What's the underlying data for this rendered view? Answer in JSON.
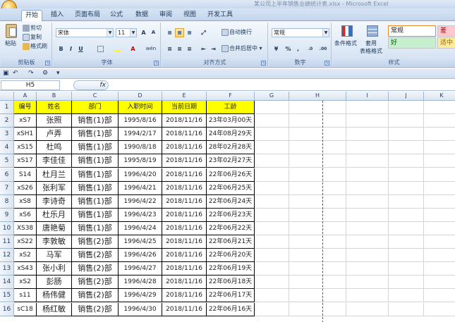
{
  "window": {
    "title": "某公司上半年销售业绩统计表.xlsx - Microsoft Excel"
  },
  "tabs": [
    {
      "label": "开始",
      "active": true
    },
    {
      "label": "插入",
      "active": false
    },
    {
      "label": "页面布局",
      "active": false
    },
    {
      "label": "公式",
      "active": false
    },
    {
      "label": "数据",
      "active": false
    },
    {
      "label": "审阅",
      "active": false
    },
    {
      "label": "视图",
      "active": false
    },
    {
      "label": "开发工具",
      "active": false
    }
  ],
  "ribbon": {
    "clipboard": {
      "label": "剪贴板",
      "paste": "粘贴",
      "cut": "剪切",
      "copy": "复制",
      "format_painter": "格式刷"
    },
    "font": {
      "label": "字体",
      "font_name": "宋体",
      "font_size": "11",
      "grow": "A",
      "shrink": "A",
      "bold": "B",
      "italic": "I",
      "underline": "U",
      "font_color_letter": "A",
      "wen": "wén"
    },
    "alignment": {
      "label": "对齐方式",
      "wrap": "自动换行",
      "merge": "合并后居中"
    },
    "number": {
      "label": "数字",
      "format": "常规",
      "percent": "%",
      "comma": ",",
      "inc": ".0",
      "dec": ".00"
    },
    "styles": {
      "label": "样式",
      "conditional": "条件格式",
      "table_format_top": "套用",
      "table_format": "表格格式",
      "normal": "常规",
      "bad": "差",
      "good": "好",
      "neutral": "适中"
    }
  },
  "formula_bar": {
    "name_box": "H5",
    "fx": "fx"
  },
  "columns": [
    "A",
    "B",
    "C",
    "D",
    "E",
    "F",
    "G",
    "H",
    "I",
    "J",
    "K"
  ],
  "table": {
    "headers": [
      "编号",
      "姓名",
      "部门",
      "入职时间",
      "当前日期",
      "工龄"
    ],
    "rows": [
      [
        "xS7",
        "张照",
        "销售(1)部",
        "1995/8/16",
        "2018/11/16",
        "23年03月00天"
      ],
      [
        "xSH1",
        "卢弄",
        "销售(1)部",
        "1994/2/17",
        "2018/11/16",
        "24年08月29天"
      ],
      [
        "xS15",
        "杜鸣",
        "销售(1)部",
        "1990/8/18",
        "2018/11/16",
        "28年02月28天"
      ],
      [
        "xS17",
        "李佳佳",
        "销售(1)部",
        "1995/8/19",
        "2018/11/16",
        "23年02月27天"
      ],
      [
        "S14",
        "杜月兰",
        "销售(1)部",
        "1996/4/20",
        "2018/11/16",
        "22年06月26天"
      ],
      [
        "xS26",
        "张利军",
        "销售(1)部",
        "1996/4/21",
        "2018/11/16",
        "22年06月25天"
      ],
      [
        "xS8",
        "李诗奇",
        "销售(1)部",
        "1996/4/22",
        "2018/11/16",
        "22年06月24天"
      ],
      [
        "xS6",
        "杜乐月",
        "销售(1)部",
        "1996/4/23",
        "2018/11/16",
        "22年06月23天"
      ],
      [
        "XS38",
        "唐艳菊",
        "销售(1)部",
        "1996/4/24",
        "2018/11/16",
        "22年06月22天"
      ],
      [
        "xS22",
        "李敦敏",
        "销售(2)部",
        "1996/4/25",
        "2018/11/16",
        "22年06月21天"
      ],
      [
        "xS2",
        "马军",
        "销售(2)部",
        "1996/4/26",
        "2018/11/16",
        "22年06月20天"
      ],
      [
        "xS43",
        "张小利",
        "销售(2)部",
        "1996/4/27",
        "2018/11/16",
        "22年06月19天"
      ],
      [
        "xS2",
        "彭肠",
        "销售(2)部",
        "1996/4/28",
        "2018/11/16",
        "22年06月18天"
      ],
      [
        "s11",
        "杨伟健",
        "销售(2)部",
        "1996/4/29",
        "2018/11/16",
        "22年06月17天"
      ],
      [
        "sC18",
        "杨红敏",
        "销售(2)部",
        "1996/4/30",
        "2018/11/16",
        "22年06月16天"
      ]
    ]
  },
  "row_numbers": [
    "1",
    "2",
    "3",
    "4",
    "5",
    "6",
    "7",
    "8",
    "9",
    "10",
    "11",
    "12",
    "13",
    "14",
    "15",
    "16"
  ],
  "colors": {
    "header_fill": "#ffff00",
    "accent": "#1e395b"
  }
}
